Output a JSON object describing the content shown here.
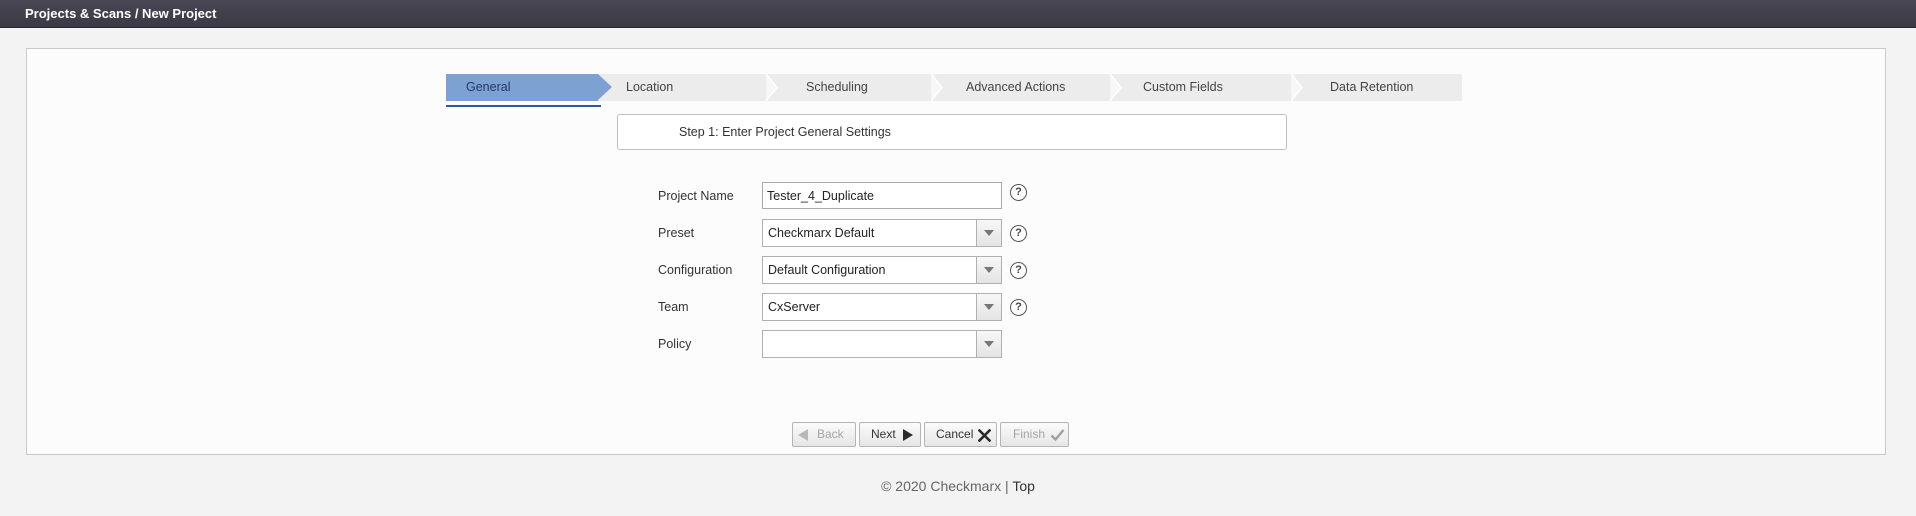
{
  "header": {
    "breadcrumb": "Projects & Scans / New Project"
  },
  "wizard": {
    "steps": [
      {
        "label": "General",
        "active": true
      },
      {
        "label": "Location",
        "active": false
      },
      {
        "label": "Scheduling",
        "active": false
      },
      {
        "label": "Advanced Actions",
        "active": false
      },
      {
        "label": "Custom Fields",
        "active": false
      },
      {
        "label": "Data Retention",
        "active": false
      }
    ],
    "step_title": "Step 1: Enter Project General Settings"
  },
  "form": {
    "project_name_label": "Project Name",
    "project_name_value": "Tester_4_Duplicate",
    "preset_label": "Preset",
    "preset_value": "Checkmarx Default",
    "configuration_label": "Configuration",
    "configuration_value": "Default Configuration",
    "team_label": "Team",
    "team_value": "CxServer",
    "policy_label": "Policy",
    "policy_value": "",
    "help_glyph": "?"
  },
  "buttons": {
    "back": "Back",
    "next": "Next",
    "cancel": "Cancel",
    "finish": "Finish"
  },
  "footer": {
    "copyright": "© 2020 Checkmarx",
    "separator": "|",
    "top_link": "Top"
  },
  "colors": {
    "active_step": "#7ea1d3",
    "step_underline": "#2b5aa8",
    "topbar": "#3f3d48"
  }
}
